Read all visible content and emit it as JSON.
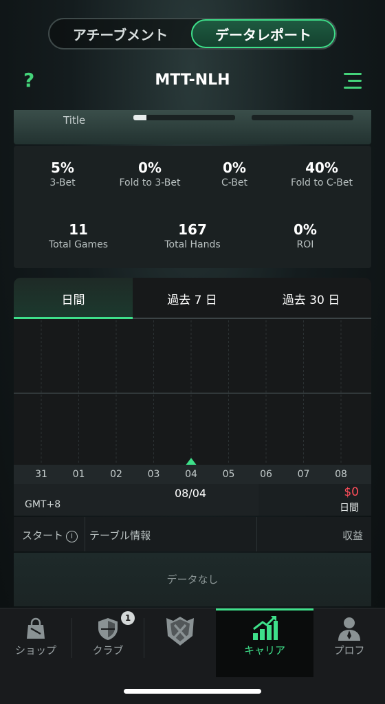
{
  "toggle": {
    "achievements": "アチーブメント",
    "report": "データレポート"
  },
  "header": {
    "help": "?",
    "title": "MTT-NLH"
  },
  "title_strip": {
    "label": "Title",
    "progress": 0.13
  },
  "stats": [
    {
      "value": "5%",
      "label": "3-Bet"
    },
    {
      "value": "0%",
      "label": "Fold to 3-Bet"
    },
    {
      "value": "0%",
      "label": "C-Bet"
    },
    {
      "value": "40%",
      "label": "Fold to C-Bet"
    },
    {
      "value": "11",
      "label": "Total Games"
    },
    {
      "value": "167",
      "label": "Total Hands"
    },
    {
      "value": "0%",
      "label": "ROI"
    }
  ],
  "tabs": [
    "日間",
    "過去 7 日",
    "過去 30 日"
  ],
  "chart_data": {
    "type": "line",
    "categories": [
      "31",
      "01",
      "02",
      "03",
      "04",
      "05",
      "06",
      "07",
      "08"
    ],
    "selected": "04",
    "values": []
  },
  "info": {
    "timezone": "GMT+8",
    "date": "08/04",
    "amount": "$0",
    "period": "日間"
  },
  "table": {
    "col_start": "スタート",
    "info_icon": "i",
    "col_table": "テーブル情報",
    "col_profit": "収益",
    "empty": "データなし"
  },
  "nav": {
    "shop": "ショップ",
    "club": "クラブ",
    "club_badge": "1",
    "career": "キャリア",
    "profile": "プロフ"
  },
  "colors": {
    "accent": "#3ee08a",
    "negative": "#ff4d5a"
  }
}
